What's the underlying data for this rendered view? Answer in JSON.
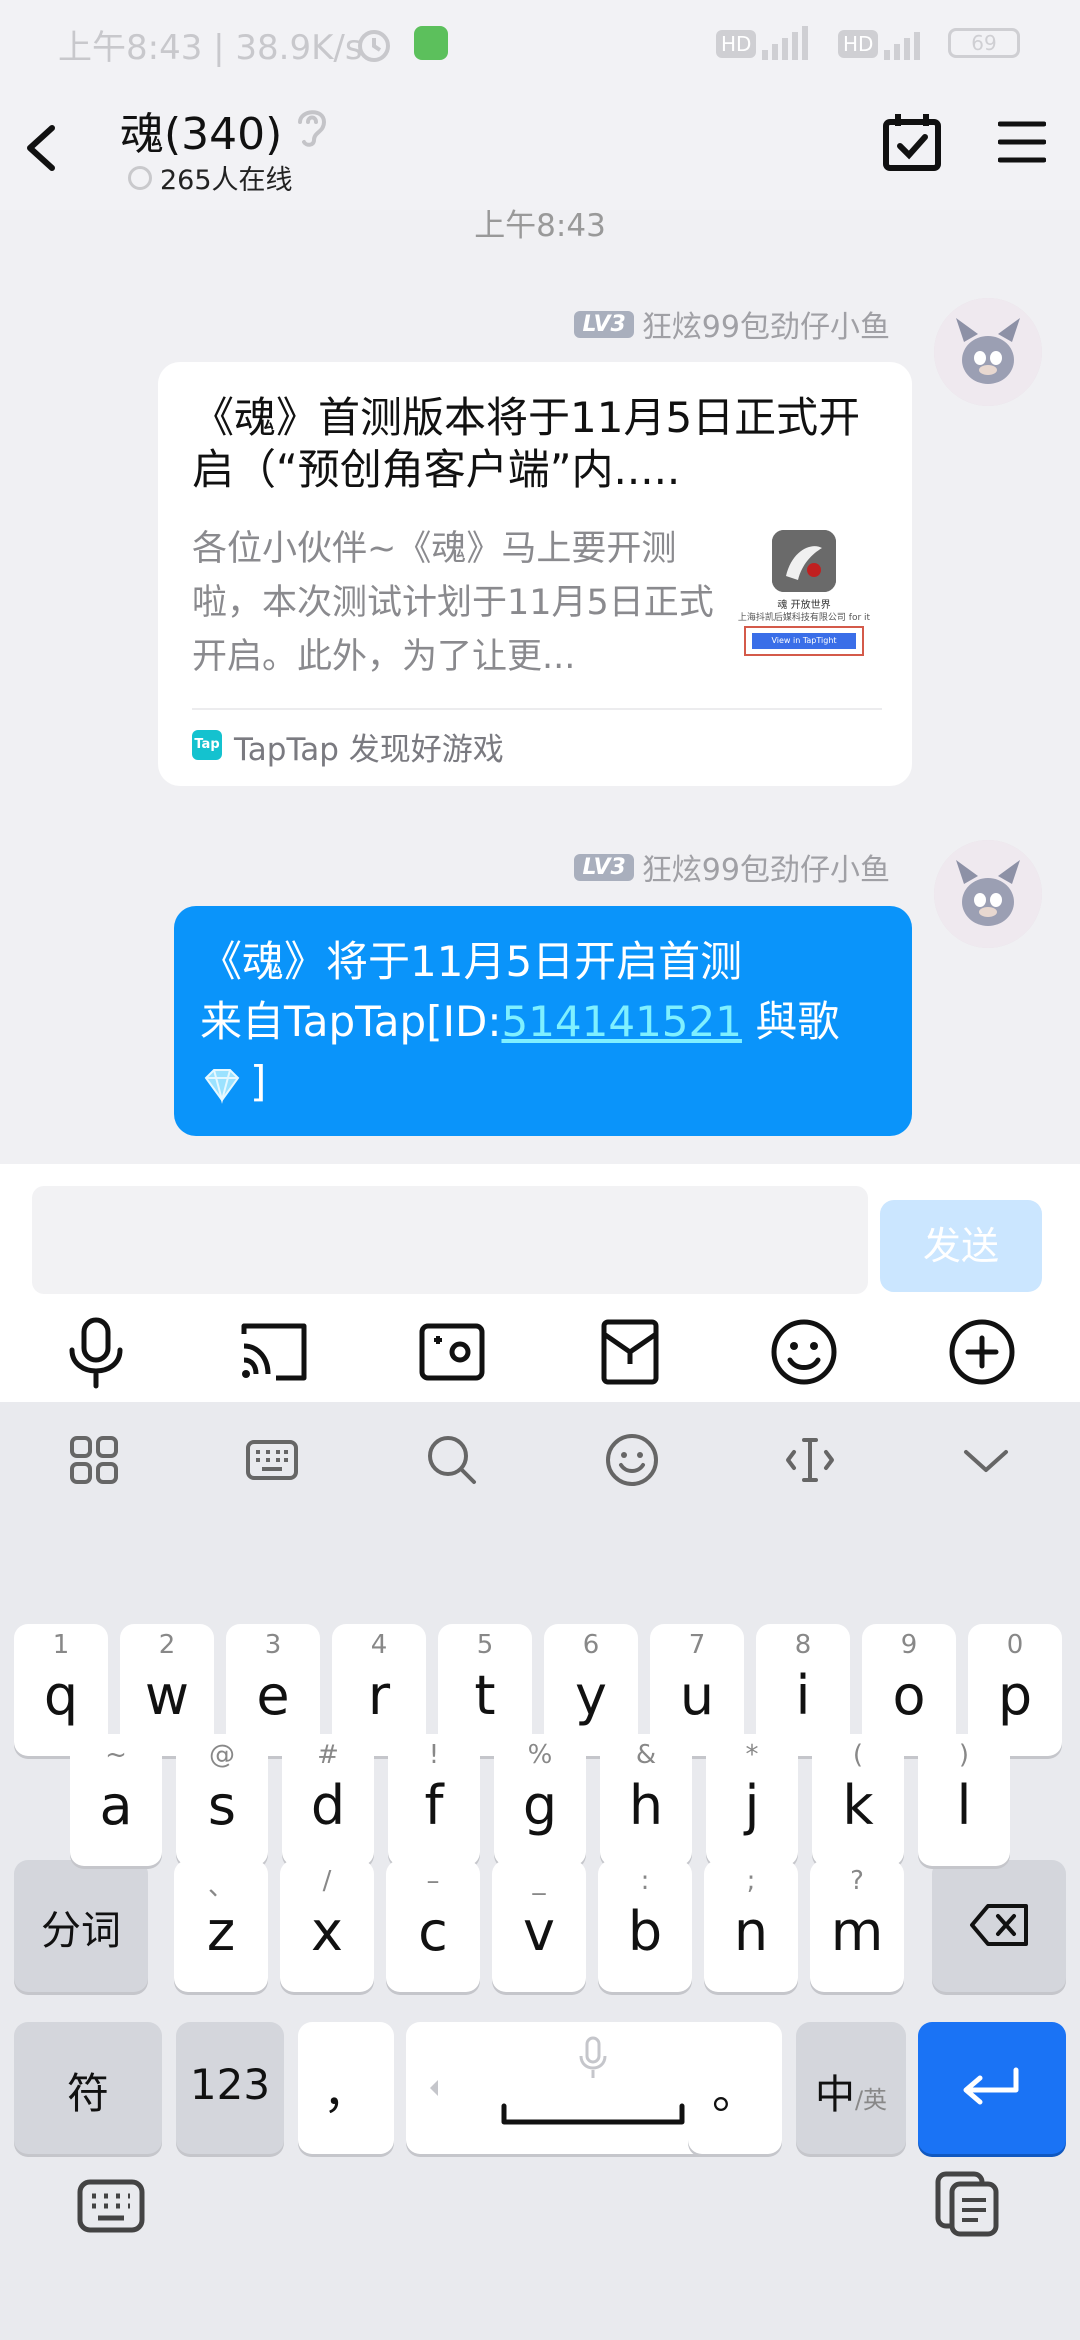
{
  "status_bar": {
    "left_text": "上午8:43 | 38.9K/s",
    "sim1_tag": "HD",
    "sim2_tag": "HD",
    "battery": "69"
  },
  "header": {
    "title": "魂(340)",
    "online_text": "265人在线",
    "icons": [
      "back-arrow-icon",
      "ear-icon",
      "calendar-check-icon",
      "menu-icon"
    ]
  },
  "chat": {
    "time_separator": "上午8:43",
    "messages": [
      {
        "level_badge": "LV3",
        "sender": "狂炫99包劲仔小鱼",
        "card_title": "《魂》首测版本将于11月5日正式开启（“预创角客户端”内.....",
        "card_desc": "各位小伙伴~《魂》马上要开测啦，本次测试计划于11月5日正式开启。此外，为了让更...",
        "thumb_title": "魂 开放世界",
        "thumb_company": "上海抖凯后媒科技有限公司 for it",
        "thumb_button": "View in TapTight",
        "source_logo": "Tap",
        "source": "TapTap 发现好游戏"
      },
      {
        "level_badge": "LV3",
        "sender": "狂炫99包劲仔小鱼",
        "line1": "《魂》将于11月5日开启首测",
        "line2_prefix": "来自TapTap[ID:",
        "id_link": "514141521",
        "line2_suffix": " 與歌",
        "line3_suffix": "]"
      }
    ]
  },
  "composer": {
    "placeholder": "",
    "send_label": "发送",
    "tools": [
      "microphone-icon",
      "cast-screen-icon",
      "photo-frame-icon",
      "envelope-icon",
      "smile-face-icon",
      "plus-circle-icon"
    ]
  },
  "keyboard": {
    "toolbar": [
      "apps-grid-icon",
      "keyboard-icon",
      "search-icon",
      "emoji-icon",
      "text-cursor-icon",
      "collapse-chevron-icon"
    ],
    "row1": [
      {
        "hint": "1",
        "key": "q"
      },
      {
        "hint": "2",
        "key": "w"
      },
      {
        "hint": "3",
        "key": "e"
      },
      {
        "hint": "4",
        "key": "r"
      },
      {
        "hint": "5",
        "key": "t"
      },
      {
        "hint": "6",
        "key": "y"
      },
      {
        "hint": "7",
        "key": "u"
      },
      {
        "hint": "8",
        "key": "i"
      },
      {
        "hint": "9",
        "key": "o"
      },
      {
        "hint": "0",
        "key": "p"
      }
    ],
    "row2": [
      {
        "hint": "~",
        "key": "a"
      },
      {
        "hint": "@",
        "key": "s"
      },
      {
        "hint": "#",
        "key": "d"
      },
      {
        "hint": "!",
        "key": "f"
      },
      {
        "hint": "%",
        "key": "g"
      },
      {
        "hint": "&",
        "key": "h"
      },
      {
        "hint": "*",
        "key": "j"
      },
      {
        "hint": "(",
        "key": "k"
      },
      {
        "hint": ")",
        "key": "l"
      }
    ],
    "row3": [
      {
        "hint": "、",
        "key": "z"
      },
      {
        "hint": "/",
        "key": "x"
      },
      {
        "hint": "–",
        "key": "c"
      },
      {
        "hint": "_",
        "key": "v"
      },
      {
        "hint": ":",
        "key": "b"
      },
      {
        "hint": ";",
        "key": "n"
      },
      {
        "hint": "?",
        "key": "m"
      }
    ],
    "fenci_label": "分词",
    "symbol_label": "符",
    "num_label": "123",
    "comma_label": "，",
    "period_label": "。",
    "lang_main": "中",
    "lang_sub": "/英"
  }
}
